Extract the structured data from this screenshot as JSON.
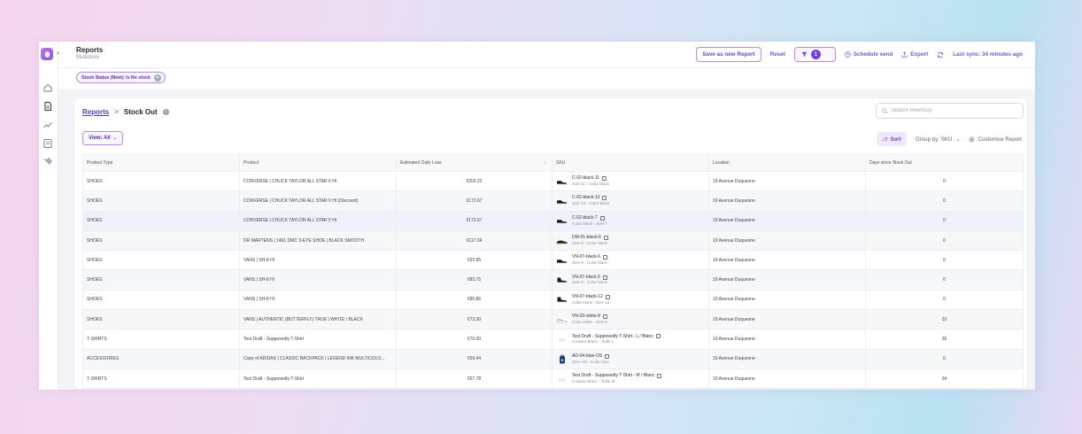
{
  "header": {
    "title": "Reports",
    "subtitle": "Multistore",
    "save_label": "Save as new Report",
    "reset_label": "Reset",
    "filter_count": "1",
    "schedule_label": "Schedule send",
    "export_label": "Export",
    "sync_label": "Last sync: 34 minutes ago"
  },
  "filters": {
    "chip_label": "Stock Status (New): Is No stock"
  },
  "breadcrumb": {
    "parent": "Reports",
    "separator": ">",
    "current": "Stock Out"
  },
  "search": {
    "placeholder": "Search Inventory"
  },
  "toolbar": {
    "view_label": "View: All",
    "sort_label": "Sort",
    "group_label": "Group by: SKU",
    "customise_label": "Customise Report"
  },
  "table": {
    "columns": [
      "Product Type",
      "Product",
      "Estimated Daily Loss",
      "SKU",
      "Location",
      "Days since Stock Out"
    ],
    "rows": [
      {
        "type": "SHOES",
        "product": "CONVERSE | CHUCK TAYLOR ALL STAR II HI",
        "loss": "€202.22",
        "sku": "C-02-black-11",
        "sku_sub": "Size 11 - Color black",
        "thumb": "shoe-black",
        "location": "19 Avenue Duquesne",
        "days": "0"
      },
      {
        "type": "SHOES",
        "product": "CONVERSE | CHUCK TAYLOR ALL STAR II HI (Discount)",
        "loss": "€172.67",
        "sku": "C-02-black-13",
        "sku_sub": "Size 13 - Color black",
        "thumb": "shoe-black",
        "location": "19 Avenue Duquesne",
        "days": "0"
      },
      {
        "type": "SHOES",
        "product": "CONVERSE | CHUCK TAYLOR ALL STAR II HI",
        "loss": "€172.67",
        "sku": "C-02-black-7",
        "sku_sub": "Color black - Size 7",
        "thumb": "shoe-black",
        "location": "19 Avenue Duquesne",
        "days": "0"
      },
      {
        "type": "SHOES",
        "product": "DR MARTENS | 1461 DMC 3-EYE SHOE | BLACK SMOOTH",
        "loss": "€117.04",
        "sku": "DM-01-black-6",
        "sku_sub": "Size 6 - Color black",
        "thumb": "shoe-low",
        "location": "19 Avenue Duquesne",
        "days": "0"
      },
      {
        "type": "SHOES",
        "product": "VANS | SH-8 HI",
        "loss": "€93.85",
        "sku": "VN-07-black-6",
        "sku_sub": "Size 6 - Color black",
        "thumb": "shoe-black",
        "location": "19 Avenue Duquesne",
        "days": "0"
      },
      {
        "type": "SHOES",
        "product": "VANS | SH-8 HI",
        "loss": "€83.75",
        "sku": "VN-07-black-5",
        "sku_sub": "Size 5 - Color black",
        "thumb": "shoe-hi",
        "location": "19 Avenue Duquesne",
        "days": "0"
      },
      {
        "type": "SHOES",
        "product": "VANS | SH-8 HI",
        "loss": "€80.86",
        "sku": "VN-07-black-12",
        "sku_sub": "Color black - Size 12",
        "thumb": "shoe-hi",
        "location": "19 Avenue Duquesne",
        "days": "0"
      },
      {
        "type": "SHOES",
        "product": "VANS | AUTHENTIC (BUTTERFLY) TRUE | WHITE / BLACK",
        "loss": "€73.30",
        "sku": "VN-03-white-8",
        "sku_sub": "Color white - Size 8",
        "thumb": "shoe-white",
        "location": "19 Avenue Duquesne",
        "days": "33"
      },
      {
        "type": "T-SHIRTS",
        "product": "Test Draft - Supposedly T-Shirt",
        "loss": "€70.00",
        "sku": "Test Draft - Supposedly T-Shirt - L / Blanc",
        "sku_sub": "Couleur Blanc - Taille L",
        "thumb": "placeholder",
        "location": "19 Avenue Duquesne",
        "days": "36"
      },
      {
        "type": "ACCESSORIES",
        "product": "Copy of ADIDAS | CLASSIC BACKPACK | LEGEND INK MULTICOLO...",
        "loss": "€69.44",
        "sku": "AD-04-blue-OS",
        "sku_sub": "Size OS - Color blue",
        "thumb": "backpack",
        "location": "19 Avenue Duquesne",
        "days": "0"
      },
      {
        "type": "T-SHIRTS",
        "product": "Test Draft - Supposedly T-Shirt",
        "loss": "€67.78",
        "sku": "Test Draft - Supposedly T-Shirt - M / Blanc",
        "sku_sub": "Couleur Blanc - Taille M",
        "thumb": "placeholder",
        "location": "19 Avenue Duquesne",
        "days": "34"
      }
    ]
  },
  "colors": {
    "accent": "#7b3fd9",
    "accent_light": "#b98ae6"
  }
}
